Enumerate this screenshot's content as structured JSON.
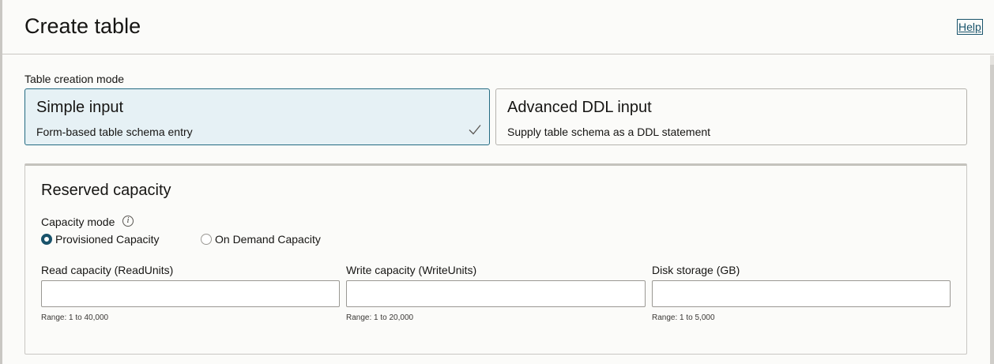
{
  "header": {
    "title": "Create table",
    "help_label": "Help"
  },
  "creation_mode": {
    "label": "Table creation mode",
    "options": [
      {
        "title": "Simple input",
        "description": "Form-based table schema entry",
        "selected": true
      },
      {
        "title": "Advanced DDL input",
        "description": "Supply table schema as a DDL statement",
        "selected": false
      }
    ]
  },
  "reserved_capacity": {
    "title": "Reserved capacity",
    "capacity_mode_label": "Capacity mode",
    "capacity_mode_info_glyph": "i",
    "capacity_modes": [
      {
        "label": "Provisioned Capacity",
        "checked": true
      },
      {
        "label": "On Demand Capacity",
        "checked": false
      }
    ],
    "fields": [
      {
        "label": "Read capacity (ReadUnits)",
        "value": "",
        "hint": "Range: 1 to 40,000"
      },
      {
        "label": "Write capacity (WriteUnits)",
        "value": "",
        "hint": "Range: 1 to 20,000"
      },
      {
        "label": "Disk storage (GB)",
        "value": "",
        "hint": "Range: 1 to 5,000"
      }
    ]
  },
  "colors": {
    "accent": "#19536b",
    "selected_bg": "#e6f1f5",
    "selected_border": "#236a82"
  },
  "icons": {
    "selected_check": "checkmark-icon",
    "info": "info-icon"
  }
}
